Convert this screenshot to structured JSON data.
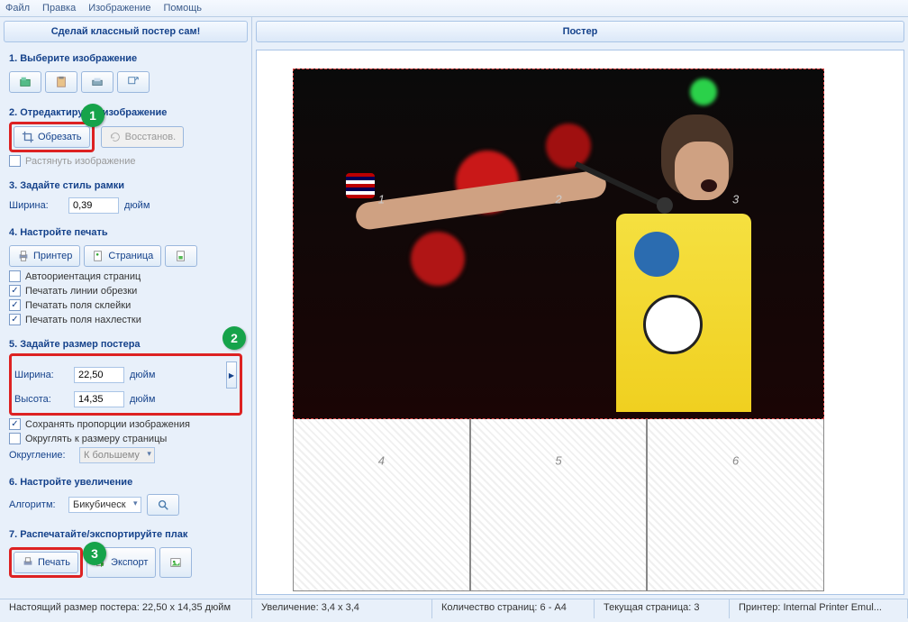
{
  "menu": {
    "file": "Файл",
    "edit": "Правка",
    "image": "Изображение",
    "help": "Помощь"
  },
  "sidebar": {
    "header": "Сделай классный постер сам!",
    "s1": {
      "title": "1. Выберите изображение"
    },
    "s2": {
      "title": "2. Отредактируйте изображение",
      "crop": "Обрезать",
      "restore": "Восстанов.",
      "stretch": "Растянуть изображение"
    },
    "s3": {
      "title": "3. Задайте стиль рамки",
      "width_label": "Ширина:",
      "width_value": "0,39",
      "unit": "дюйм"
    },
    "s4": {
      "title": "4. Настройте печать",
      "printer": "Принтер",
      "page": "Страница",
      "auto_orient": "Автоориентация страниц",
      "cut_lines": "Печатать линии обрезки",
      "glue_fields": "Печатать поля склейки",
      "overlap_fields": "Печатать поля нахлестки"
    },
    "s5": {
      "title": "5. Задайте размер постера",
      "width_label": "Ширина:",
      "width_value": "22,50",
      "height_label": "Высота:",
      "height_value": "14,35",
      "unit": "дюйм",
      "keep_ratio": "Сохранять пропорции изображения",
      "round_page": "Округлять к размеру страницы",
      "rounding_label": "Округление:",
      "rounding_value": "К большему"
    },
    "s6": {
      "title": "6. Настройте увеличение",
      "algo_label": "Алгоритм:",
      "algo_value": "Бикубическ"
    },
    "s7": {
      "title": "7. Распечатайте/экспортируйте плак",
      "print": "Печать",
      "export": "Экспорт"
    }
  },
  "content": {
    "header": "Постер",
    "pages": [
      "1",
      "2",
      "3",
      "4",
      "5",
      "6"
    ]
  },
  "status": {
    "real_size": "Настоящий размер постера: 22,50 x 14,35 дюйм",
    "zoom": "Увеличение: 3,4 x 3,4",
    "page_count": "Количество страниц: 6 - A4",
    "current_page": "Текущая страница: 3",
    "printer": "Принтер: Internal Printer Emul..."
  },
  "markers": {
    "m1": "1",
    "m2": "2",
    "m3": "3"
  }
}
